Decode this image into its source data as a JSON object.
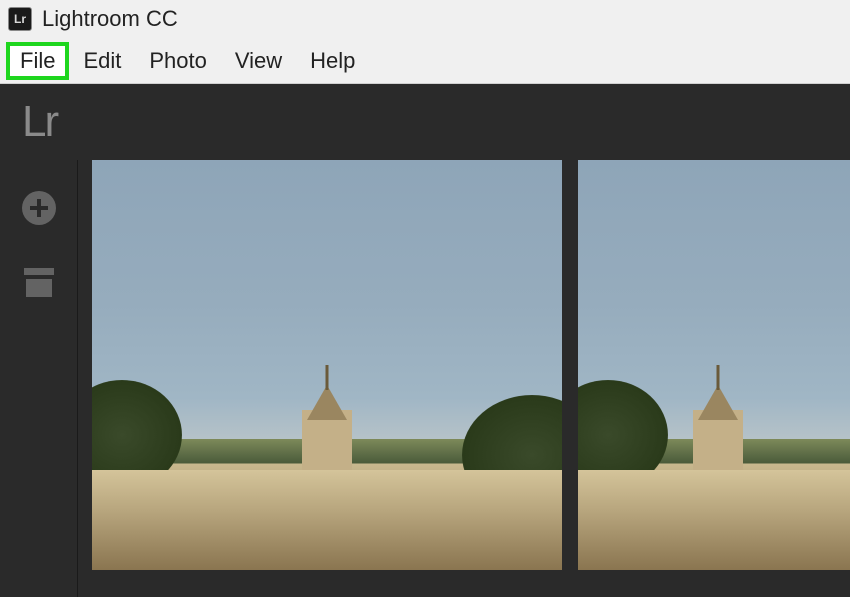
{
  "title_bar": {
    "app_icon_label": "Lr",
    "title": "Lightroom CC"
  },
  "menu_bar": {
    "items": [
      {
        "label": "File",
        "highlighted": true
      },
      {
        "label": "Edit",
        "highlighted": false
      },
      {
        "label": "Photo",
        "highlighted": false
      },
      {
        "label": "View",
        "highlighted": false
      },
      {
        "label": "Help",
        "highlighted": false
      }
    ]
  },
  "brand": {
    "logo_text": "Lr"
  },
  "left_rail": {
    "add_button": "add-photo",
    "archive_button": "archive"
  },
  "thumbnails": [
    {
      "alt": "Sky and building with trees"
    },
    {
      "alt": "Sky and building with trees (partial)"
    }
  ],
  "highlight": {
    "color": "#1ed61e"
  }
}
